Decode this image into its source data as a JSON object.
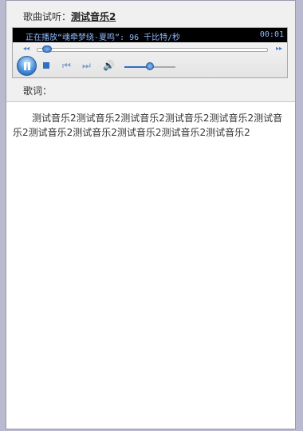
{
  "header": {
    "song_label": "歌曲试听：",
    "song_title": "测试音乐2"
  },
  "player": {
    "status_text": "正在播放“魂牵梦绕-夏鸣”: 96 千比特/秒",
    "time": "00:01",
    "skip_back_icon": "◂◂",
    "skip_forward_icon": "▸▸",
    "prev_icon": "⏮",
    "next_icon": "⏭",
    "volume_icon": "🔊",
    "seek_progress": 0.02,
    "volume_level": 0.5
  },
  "lyrics": {
    "label": "歌词：",
    "text": "测试音乐2测试音乐2测试音乐2测试音乐2测试音乐2测试音乐2测试音乐2测试音乐2测试音乐2测试音乐2测试音乐2"
  },
  "colors": {
    "accent": "#2f6fbf",
    "status_text": "#8fb8ff",
    "background": "#b9b9cf"
  }
}
